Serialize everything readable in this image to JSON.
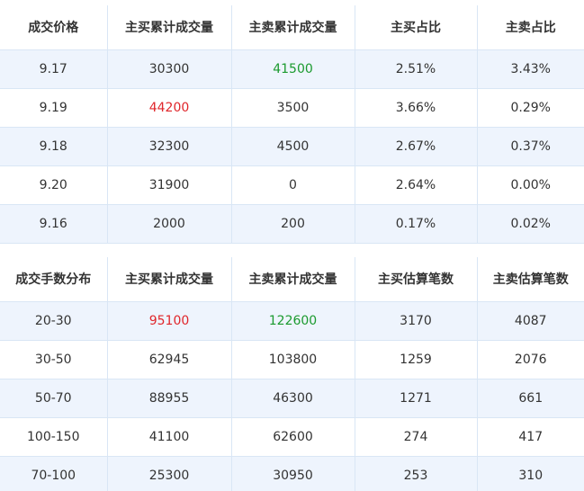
{
  "price_table": {
    "headers": [
      "成交价格",
      "主买累计成交量",
      "主卖累计成交量",
      "主买占比",
      "主卖占比"
    ],
    "rows": [
      [
        "9.17",
        "30300",
        "41500",
        "2.51%",
        "3.43%"
      ],
      [
        "9.19",
        "44200",
        "3500",
        "3.66%",
        "0.29%"
      ],
      [
        "9.18",
        "32300",
        "4500",
        "2.67%",
        "0.37%"
      ],
      [
        "9.20",
        "31900",
        "0",
        "2.64%",
        "0.00%"
      ],
      [
        "9.16",
        "2000",
        "200",
        "0.17%",
        "0.02%"
      ]
    ]
  },
  "lot_table": {
    "headers": [
      "成交手数分布",
      "主买累计成交量",
      "主卖累计成交量",
      "主买估算笔数",
      "主卖估算笔数"
    ],
    "rows": [
      [
        "20-30",
        "95100",
        "122600",
        "3170",
        "4087"
      ],
      [
        "30-50",
        "62945",
        "103800",
        "1259",
        "2076"
      ],
      [
        "50-70",
        "88955",
        "46300",
        "1271",
        "661"
      ],
      [
        "100-150",
        "41100",
        "62600",
        "274",
        "417"
      ],
      [
        "70-100",
        "25300",
        "30950",
        "253",
        "310"
      ]
    ]
  },
  "colors": {
    "max_buy": "#e0262b",
    "max_sell": "#1b9a2f",
    "stripe": "#eef4fd",
    "border": "#d9e6f5"
  }
}
